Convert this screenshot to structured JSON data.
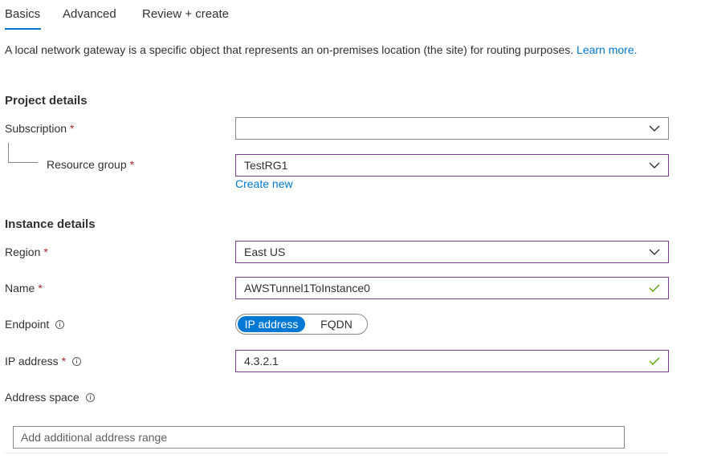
{
  "tabs": [
    {
      "label": "Basics",
      "active": true
    },
    {
      "label": "Advanced",
      "active": false
    },
    {
      "label": "Review + create",
      "active": false
    }
  ],
  "description": {
    "text": "A local network gateway is a specific object that represents an on-premises location (the site) for routing purposes.",
    "link": "Learn more."
  },
  "project_details": {
    "heading": "Project details",
    "subscription": {
      "label": "Subscription",
      "required": "*",
      "value": ""
    },
    "resource_group": {
      "label": "Resource group",
      "required": "*",
      "value": "TestRG1",
      "create_new": "Create new"
    }
  },
  "instance_details": {
    "heading": "Instance details",
    "region": {
      "label": "Region",
      "required": "*",
      "value": "East US"
    },
    "name": {
      "label": "Name",
      "required": "*",
      "value": "AWSTunnel1ToInstance0",
      "valid": true
    },
    "endpoint": {
      "label": "Endpoint",
      "options": [
        "IP address",
        "FQDN"
      ],
      "selected": "IP address"
    },
    "ip_address": {
      "label": "IP address",
      "required": "*",
      "value": "4.3.2.1",
      "valid": true
    },
    "address_space": {
      "label": "Address space",
      "placeholder": "Add additional address range"
    }
  },
  "colors": {
    "accent": "#0078d4",
    "required": "#a4262c",
    "valid": "#57a300",
    "focus_border": "#7a3c94"
  },
  "icons": {
    "dropdown": "chevron-down-icon",
    "valid": "checkmark-icon",
    "info": "info-icon"
  }
}
